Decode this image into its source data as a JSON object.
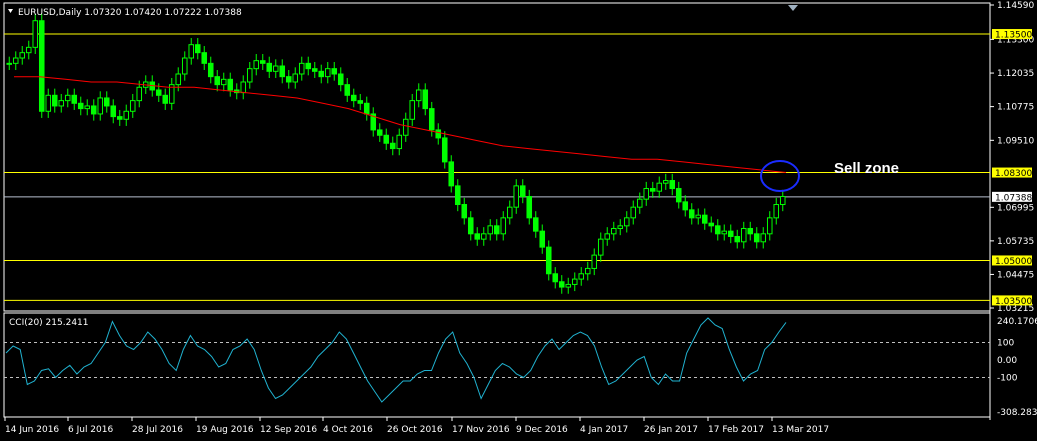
{
  "window": {
    "symbol_header": "EURUSD,Daily  1.07320 1.07420 1.07222 1.07388",
    "menu_arrow": "triangle-down-icon"
  },
  "annotation": {
    "sell_zone": "Sell zone"
  },
  "colors": {
    "background": "#000000",
    "bull_candle": "#00ff00",
    "ma_line": "#ff0000",
    "hline": "#ffff00",
    "cci_line": "#20b2d0",
    "circle": "#0000ff",
    "axis_text": "#ffffff"
  },
  "price_axis": {
    "ticks": [
      "1.14590",
      "1.13300",
      "1.12035",
      "1.10775",
      "1.09510",
      "1.06995",
      "1.05735",
      "1.04475",
      "1.03215"
    ],
    "badges": [
      {
        "text": "1.13500",
        "style": "yellow"
      },
      {
        "text": "1.08300",
        "style": "yellow"
      },
      {
        "text": "1.07388",
        "style": "white"
      },
      {
        "text": "1.05000",
        "style": "yellow"
      },
      {
        "text": "1.03500",
        "style": "yellow"
      }
    ]
  },
  "cci": {
    "label": "CCI(20) 215.2411",
    "ticks": [
      "240.1706",
      "100",
      "0.00",
      "-100",
      "-308.2831"
    ]
  },
  "time_axis": {
    "labels": [
      "14 Jun 2016",
      "6 Jul 2016",
      "28 Jul 2016",
      "19 Aug 2016",
      "12 Sep 2016",
      "4 Oct 2016",
      "26 Oct 2016",
      "17 Nov 2016",
      "9 Dec 2016",
      "4 Jan 2017",
      "26 Jan 2017",
      "17 Feb 2017",
      "13 Mar 2017"
    ]
  },
  "chart_data": {
    "type": "candlestick",
    "price_ylim": [
      1.03215,
      1.1459
    ],
    "horizontal_levels": [
      1.135,
      1.083,
      1.07388,
      1.05,
      1.035
    ],
    "close_series": [
      1.124,
      1.126,
      1.128,
      1.13,
      1.14,
      1.106,
      1.112,
      1.108,
      1.11,
      1.112,
      1.109,
      1.107,
      1.108,
      1.105,
      1.111,
      1.108,
      1.104,
      1.103,
      1.106,
      1.11,
      1.115,
      1.117,
      1.114,
      1.112,
      1.109,
      1.116,
      1.12,
      1.126,
      1.131,
      1.128,
      1.124,
      1.119,
      1.116,
      1.118,
      1.114,
      1.113,
      1.117,
      1.122,
      1.125,
      1.124,
      1.121,
      1.123,
      1.119,
      1.117,
      1.12,
      1.124,
      1.122,
      1.121,
      1.119,
      1.122,
      1.12,
      1.116,
      1.112,
      1.11,
      1.109,
      1.105,
      1.099,
      1.097,
      1.094,
      1.092,
      1.097,
      1.103,
      1.11,
      1.114,
      1.107,
      1.099,
      1.096,
      1.087,
      1.078,
      1.071,
      1.066,
      1.06,
      1.058,
      1.06,
      1.063,
      1.06,
      1.066,
      1.07,
      1.078,
      1.074,
      1.066,
      1.061,
      1.055,
      1.045,
      1.042,
      1.04,
      1.041,
      1.043,
      1.045,
      1.047,
      1.052,
      1.058,
      1.06,
      1.062,
      1.063,
      1.066,
      1.07,
      1.073,
      1.077,
      1.076,
      1.079,
      1.08,
      1.077,
      1.072,
      1.069,
      1.066,
      1.067,
      1.064,
      1.063,
      1.06,
      1.061,
      1.059,
      1.057,
      1.062,
      1.06,
      1.057,
      1.06,
      1.066,
      1.071,
      1.074
    ],
    "ma_series": [
      1.119,
      1.119,
      1.118,
      1.117,
      1.117,
      1.116,
      1.115,
      1.115,
      1.114,
      1.113,
      1.112,
      1.111,
      1.109,
      1.107,
      1.104,
      1.101,
      1.099,
      1.097,
      1.095,
      1.093,
      1.092,
      1.091,
      1.09,
      1.089,
      1.088,
      1.088,
      1.087,
      1.086,
      1.085,
      1.084,
      1.083
    ],
    "cci_ylim": [
      -308.2831,
      240.1706
    ],
    "cci_series": [
      40,
      80,
      60,
      -140,
      -120,
      -60,
      -50,
      -100,
      -60,
      -30,
      -80,
      -40,
      -20,
      40,
      100,
      220,
      140,
      80,
      60,
      100,
      160,
      120,
      60,
      -20,
      -60,
      60,
      140,
      80,
      60,
      20,
      -40,
      -20,
      60,
      80,
      120,
      60,
      -60,
      -160,
      -220,
      -200,
      -160,
      -120,
      -80,
      -40,
      20,
      60,
      100,
      160,
      120,
      40,
      -40,
      -120,
      -180,
      -240,
      -200,
      -160,
      -120,
      -120,
      -80,
      -60,
      -60,
      40,
      120,
      160,
      40,
      -20,
      -100,
      -220,
      -140,
      -60,
      -20,
      -40,
      -80,
      -100,
      -60,
      20,
      80,
      120,
      60,
      100,
      140,
      160,
      140,
      80,
      -40,
      -140,
      -120,
      -80,
      -40,
      0,
      20,
      -100,
      -140,
      -80,
      -120,
      -120,
      40,
      120,
      200,
      240,
      200,
      180,
      60,
      -40,
      -120,
      -80,
      -60,
      60,
      100,
      160,
      215
    ]
  }
}
